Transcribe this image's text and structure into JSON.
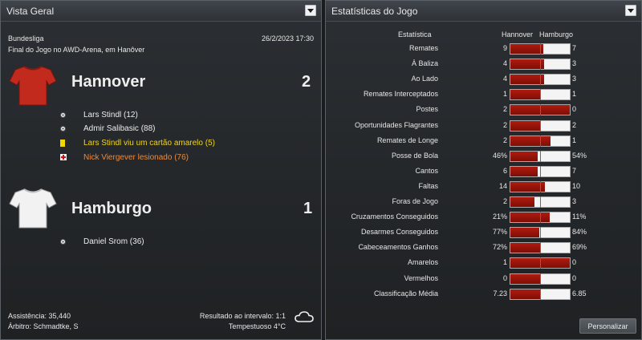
{
  "overview": {
    "title": "Vista Geral",
    "competition": "Bundesliga",
    "datetime": "26/2/2023 17:30",
    "description": "Final do Jogo no AWD-Arena, em Hanôver",
    "home": {
      "name": "Hannover",
      "score": "2",
      "shirt_color": "#c22a1e",
      "events": [
        {
          "icon": "ball-icon",
          "text": "Lars Stindl (12)",
          "color": "#ececec"
        },
        {
          "icon": "ball-icon",
          "text": "Admir Salibasic (88)",
          "color": "#ececec"
        },
        {
          "icon": "yellow-card-icon",
          "text": "Lars Stindl viu um cartão amarelo (5)",
          "color": "#f1d41a"
        },
        {
          "icon": "injury-icon",
          "text": "Nick Viergever lesionado (76)",
          "color": "#ec8a3c"
        }
      ]
    },
    "away": {
      "name": "Hamburgo",
      "score": "1",
      "shirt_color": "#f2f2f2",
      "events": [
        {
          "icon": "ball-icon",
          "text": "Daniel Srom (36)",
          "color": "#ececec"
        }
      ]
    },
    "attendance": "Assistência: 35,440",
    "referee": "Árbitro: Schmadtke, S",
    "halftime": "Resultado ao intervalo: 1:1",
    "weather": "Tempestuoso 4°C",
    "weather_icon": "cloud-icon"
  },
  "stats": {
    "title": "Estatísticas do Jogo",
    "header": {
      "stat": "Estatística",
      "home": "Hannover",
      "away": "Hamburgo"
    },
    "button_label": "Personalizar",
    "bar_color": "#9a140b",
    "rows": [
      {
        "label": "Remates",
        "home": "9",
        "away": "7",
        "share": 0.56
      },
      {
        "label": "À Baliza",
        "home": "4",
        "away": "3",
        "share": 0.57
      },
      {
        "label": "Ao Lado",
        "home": "4",
        "away": "3",
        "share": 0.57
      },
      {
        "label": "Remates Interceptados",
        "home": "1",
        "away": "1",
        "share": 0.5
      },
      {
        "label": "Postes",
        "home": "2",
        "away": "0",
        "share": 1.0
      },
      {
        "label": "Oportunidades Flagrantes",
        "home": "2",
        "away": "2",
        "share": 0.5
      },
      {
        "label": "Remates de Longe",
        "home": "2",
        "away": "1",
        "share": 0.67
      },
      {
        "label": "Posse de Bola",
        "home": "46%",
        "away": "54%",
        "share": 0.46
      },
      {
        "label": "Cantos",
        "home": "6",
        "away": "7",
        "share": 0.46
      },
      {
        "label": "Faltas",
        "home": "14",
        "away": "10",
        "share": 0.58
      },
      {
        "label": "Foras de Jogo",
        "home": "2",
        "away": "3",
        "share": 0.4
      },
      {
        "label": "Cruzamentos Conseguidos",
        "home": "21%",
        "away": "11%",
        "share": 0.66
      },
      {
        "label": "Desarmes Conseguidos",
        "home": "77%",
        "away": "84%",
        "share": 0.48
      },
      {
        "label": "Cabeceamentos Ganhos",
        "home": "72%",
        "away": "69%",
        "share": 0.51
      },
      {
        "label": "Amarelos",
        "home": "1",
        "away": "0",
        "share": 1.0
      },
      {
        "label": "Vermelhos",
        "home": "0",
        "away": "0",
        "share": 0.5
      },
      {
        "label": "Classificação Média",
        "home": "7.23",
        "away": "6.85",
        "share": 0.51
      }
    ]
  }
}
